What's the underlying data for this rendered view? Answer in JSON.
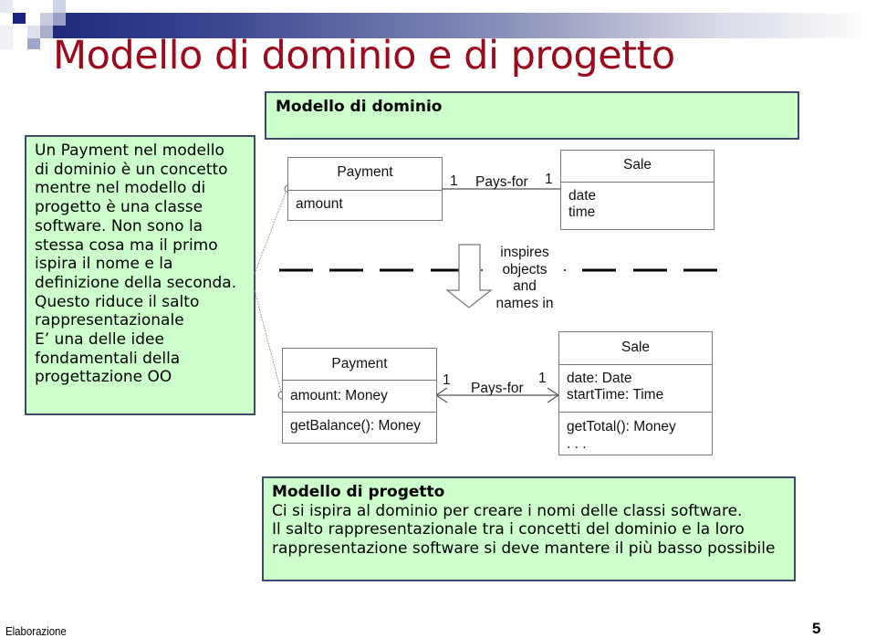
{
  "slide": {
    "title": "Modello di dominio e di progetto",
    "title_color": "#9c0a1e",
    "accent_color": "#1f2a7a",
    "note_color": "#ccffcc"
  },
  "domain_note": {
    "heading": "Modello di dominio"
  },
  "left_note": {
    "lines": [
      "Un Payment nel modello",
      "di dominio è un concetto",
      "mentre nel modello di",
      "progetto è una classe",
      "software. Non sono la",
      "stessa cosa ma il primo",
      "ispira il nome e la",
      "definizione della seconda.",
      "Questo riduce il salto",
      "rappresentazionale",
      "E’ una delle idee",
      "fondamentali della",
      "progettazione OO"
    ]
  },
  "design_note": {
    "heading": "Modello di progetto",
    "lines": [
      "Ci si ispira al dominio per creare i nomi delle classi software.",
      "Il salto rappresentazionale tra i concetti del dominio e la loro",
      "rappresentazione software si deve mantere il più basso possibile"
    ]
  },
  "diagram": {
    "domain_model": {
      "payment": {
        "name": "Payment",
        "attributes": [
          "amount"
        ]
      },
      "sale": {
        "name": "Sale",
        "attributes": [
          "date",
          "time"
        ]
      },
      "association": {
        "label": "Pays-for",
        "left_mult": "1",
        "right_mult": "1"
      }
    },
    "inspires_label": [
      "inspires",
      "objects",
      "and",
      "names in"
    ],
    "design_model": {
      "payment": {
        "name": "Payment",
        "attributes": [
          "amount: Money"
        ],
        "operations": [
          "getBalance(): Money"
        ]
      },
      "sale": {
        "name": "Sale",
        "attributes": [
          "date: Date",
          "startTime: Time"
        ],
        "operations": [
          "getTotal(): Money",
          ". . ."
        ]
      },
      "association": {
        "label": "Pays-for",
        "left_mult": "1",
        "right_mult": "1"
      }
    }
  },
  "footer": {
    "section": "Elaborazione",
    "page_number": "5"
  }
}
